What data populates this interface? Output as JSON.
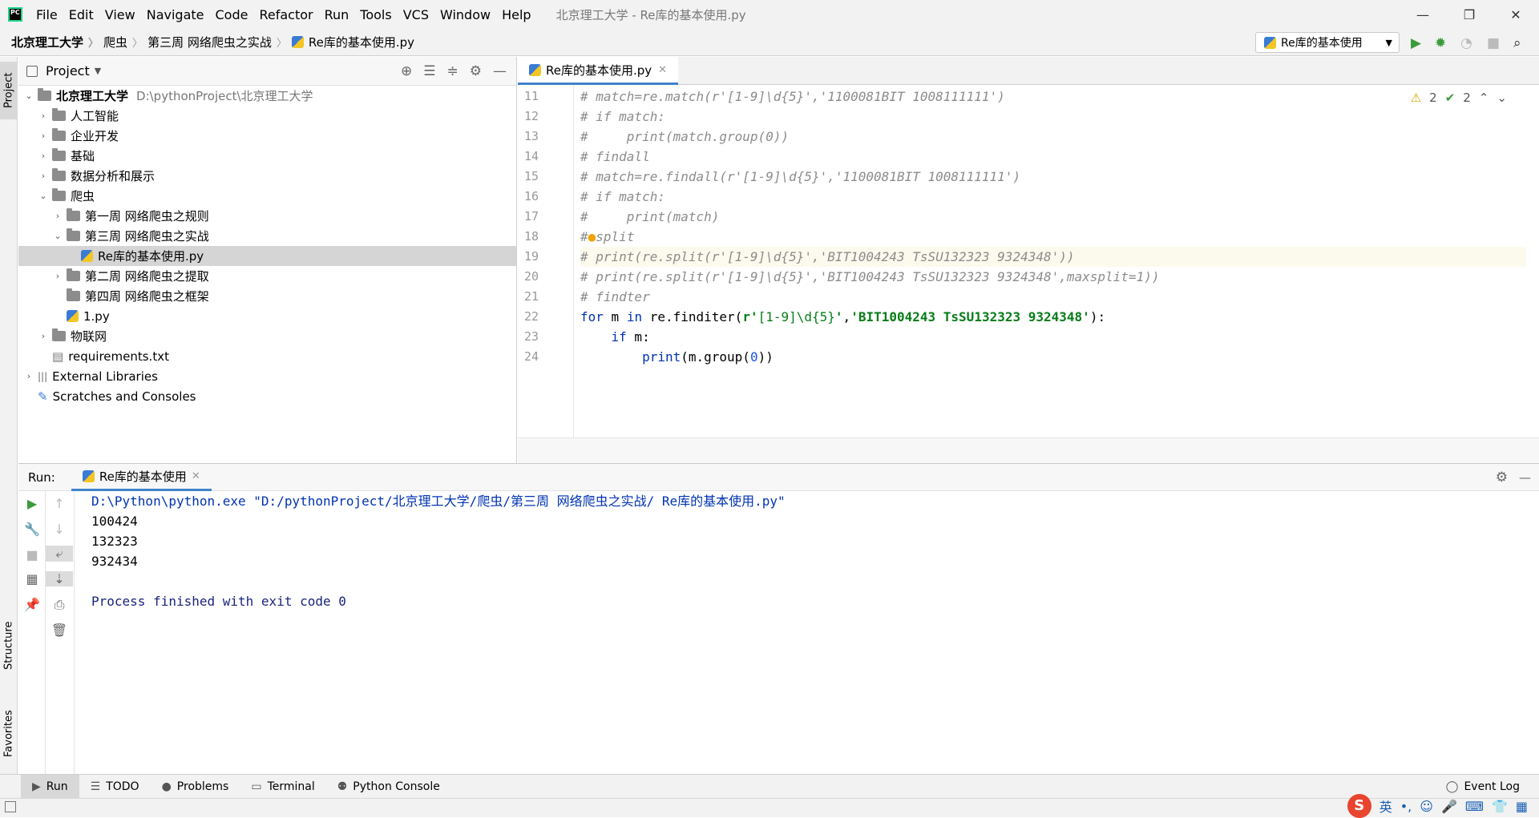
{
  "window": {
    "title": "北京理工大学 - Re库的基本使用.py",
    "minimize": "—",
    "restore": "❐",
    "close": "✕"
  },
  "menu": [
    "File",
    "Edit",
    "View",
    "Navigate",
    "Code",
    "Refactor",
    "Run",
    "Tools",
    "VCS",
    "Window",
    "Help"
  ],
  "breadcrumb": [
    "北京理工大学",
    "爬虫",
    "第三周 网络爬虫之实战",
    "Re库的基本使用.py"
  ],
  "run_config": {
    "label": "Re库的基本使用"
  },
  "sidebar_tabs": {
    "project": "Project",
    "structure": "Structure",
    "favorites": "Favorites"
  },
  "project": {
    "header": "Project",
    "tree": [
      {
        "label": "北京理工大学",
        "hint": "D:\\pythonProject\\北京理工大学",
        "level": 0,
        "arrow": "⌄",
        "type": "folder"
      },
      {
        "label": "人工智能",
        "level": 1,
        "arrow": "›",
        "type": "folder"
      },
      {
        "label": "企业开发",
        "level": 1,
        "arrow": "›",
        "type": "folder"
      },
      {
        "label": "基础",
        "level": 1,
        "arrow": "›",
        "type": "folder"
      },
      {
        "label": "数据分析和展示",
        "level": 1,
        "arrow": "›",
        "type": "folder"
      },
      {
        "label": "爬虫",
        "level": 1,
        "arrow": "⌄",
        "type": "folder"
      },
      {
        "label": "第一周 网络爬虫之规则",
        "level": 2,
        "arrow": "›",
        "type": "folder"
      },
      {
        "label": "第三周 网络爬虫之实战",
        "level": 2,
        "arrow": "⌄",
        "type": "folder"
      },
      {
        "label": "Re库的基本使用.py",
        "level": 3,
        "arrow": "",
        "type": "py",
        "selected": true
      },
      {
        "label": "第二周 网络爬虫之提取",
        "level": 2,
        "arrow": "›",
        "type": "folder"
      },
      {
        "label": "第四周 网络爬虫之框架",
        "level": 2,
        "arrow": "",
        "type": "folder"
      },
      {
        "label": "1.py",
        "level": 2,
        "arrow": "",
        "type": "py"
      },
      {
        "label": "物联网",
        "level": 1,
        "arrow": "›",
        "type": "folder"
      },
      {
        "label": "requirements.txt",
        "level": 1,
        "arrow": "",
        "type": "txt"
      },
      {
        "label": "External Libraries",
        "level": 0,
        "arrow": "›",
        "type": "lib"
      },
      {
        "label": "Scratches and Consoles",
        "level": 0,
        "arrow": "",
        "type": "scratch"
      }
    ]
  },
  "editor": {
    "tab": "Re库的基本使用.py",
    "inspections": {
      "warnings": "2",
      "weak": "2"
    },
    "lines": [
      {
        "n": "11",
        "html": "<span class='cm'># match=re.match(r'[1-9]\\d{5}','1100081BIT 1008111111')</span>"
      },
      {
        "n": "12",
        "html": "<span class='cm'># if match:</span>"
      },
      {
        "n": "13",
        "html": "<span class='cm'>#     print(match.group(0))</span>"
      },
      {
        "n": "14",
        "html": "<span class='cm'># findall</span>"
      },
      {
        "n": "15",
        "html": "<span class='cm'># match=re.findall(r'[1-9]\\d{5}','1100081BIT 1008111111')</span>"
      },
      {
        "n": "16",
        "html": "<span class='cm'># if match:</span>"
      },
      {
        "n": "17",
        "html": "<span class='cm'>#     print(match)</span>"
      },
      {
        "n": "18",
        "html": "<span class='cm'>#</span><span style='color:#f0a30a'>●</span><span class='cm'>split</span>"
      },
      {
        "n": "19",
        "html": "<span class='cm'># print(re.split(r'[1-9]\\d{5}','BIT1004243 TsSU132323 9324348'))</span>",
        "hl": true
      },
      {
        "n": "20",
        "html": "<span class='cm'># print(re.split(r'[1-9]\\d{5}','BIT1004243 TsSU132323 9324348',maxsplit=1))</span>"
      },
      {
        "n": "21",
        "html": "<span class='cm'># findter</span>"
      },
      {
        "n": "22",
        "html": "<span class='kw'>for</span> m <span class='kw'>in</span> re.finditer(<span class='st'>r'</span><span class='rx'>[1-9]\\d{5}</span><span class='st'>'</span>,<span class='st'>'BIT1004243 TsSU132323 9324348'</span>):"
      },
      {
        "n": "23",
        "html": "    <span class='kw'>if</span> m:"
      },
      {
        "n": "24",
        "html": "        <span class='kw'>print</span>(m.group(<span class='num'>0</span>))"
      }
    ]
  },
  "run": {
    "label": "Run:",
    "tab": "Re库的基本使用",
    "output": [
      {
        "text": "D:\\Python\\python.exe \"D:/pythonProject/北京理工大学/爬虫/第三周 网络爬虫之实战/ Re库的基本使用.py\"",
        "cls": "blue"
      },
      {
        "text": "100424",
        "cls": ""
      },
      {
        "text": "132323",
        "cls": ""
      },
      {
        "text": "932434",
        "cls": ""
      },
      {
        "text": "",
        "cls": ""
      },
      {
        "text": "Process finished with exit code 0",
        "cls": "navy"
      }
    ]
  },
  "bottom_tools": [
    "Run",
    "TODO",
    "Problems",
    "Terminal",
    "Python Console"
  ],
  "event_log": "Event Log",
  "ime": {
    "lang": "英"
  }
}
